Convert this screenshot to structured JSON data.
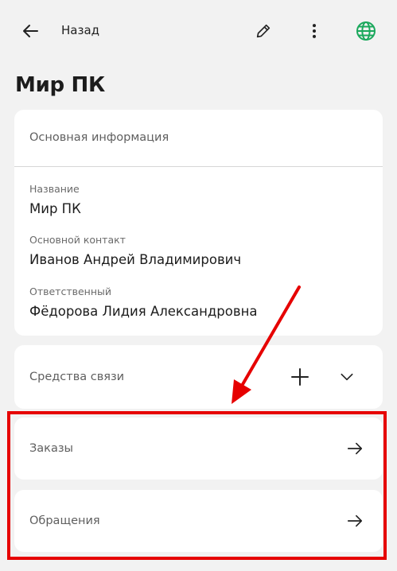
{
  "header": {
    "back_label": "Назад"
  },
  "page": {
    "title": "Мир ПК"
  },
  "info": {
    "section_title": "Основная информация",
    "fields": [
      {
        "label": "Название",
        "value": "Мир ПК"
      },
      {
        "label": "Основной контакт",
        "value": "Иванов Андрей Владимирович"
      },
      {
        "label": "Ответственный",
        "value": "Фёдорова Лидия Александровна"
      }
    ]
  },
  "contacts": {
    "title": "Средства связи"
  },
  "orders": {
    "title": "Заказы"
  },
  "appeals": {
    "title": "Обращения"
  },
  "colors": {
    "globe": "#1aa85c",
    "annotation": "#e60000",
    "background": "#f2f2f2",
    "card": "#ffffff"
  },
  "icons": [
    "back-arrow-icon",
    "pencil-icon",
    "more-vertical-icon",
    "globe-icon",
    "plus-icon",
    "chevron-down-icon",
    "arrow-right-icon"
  ]
}
